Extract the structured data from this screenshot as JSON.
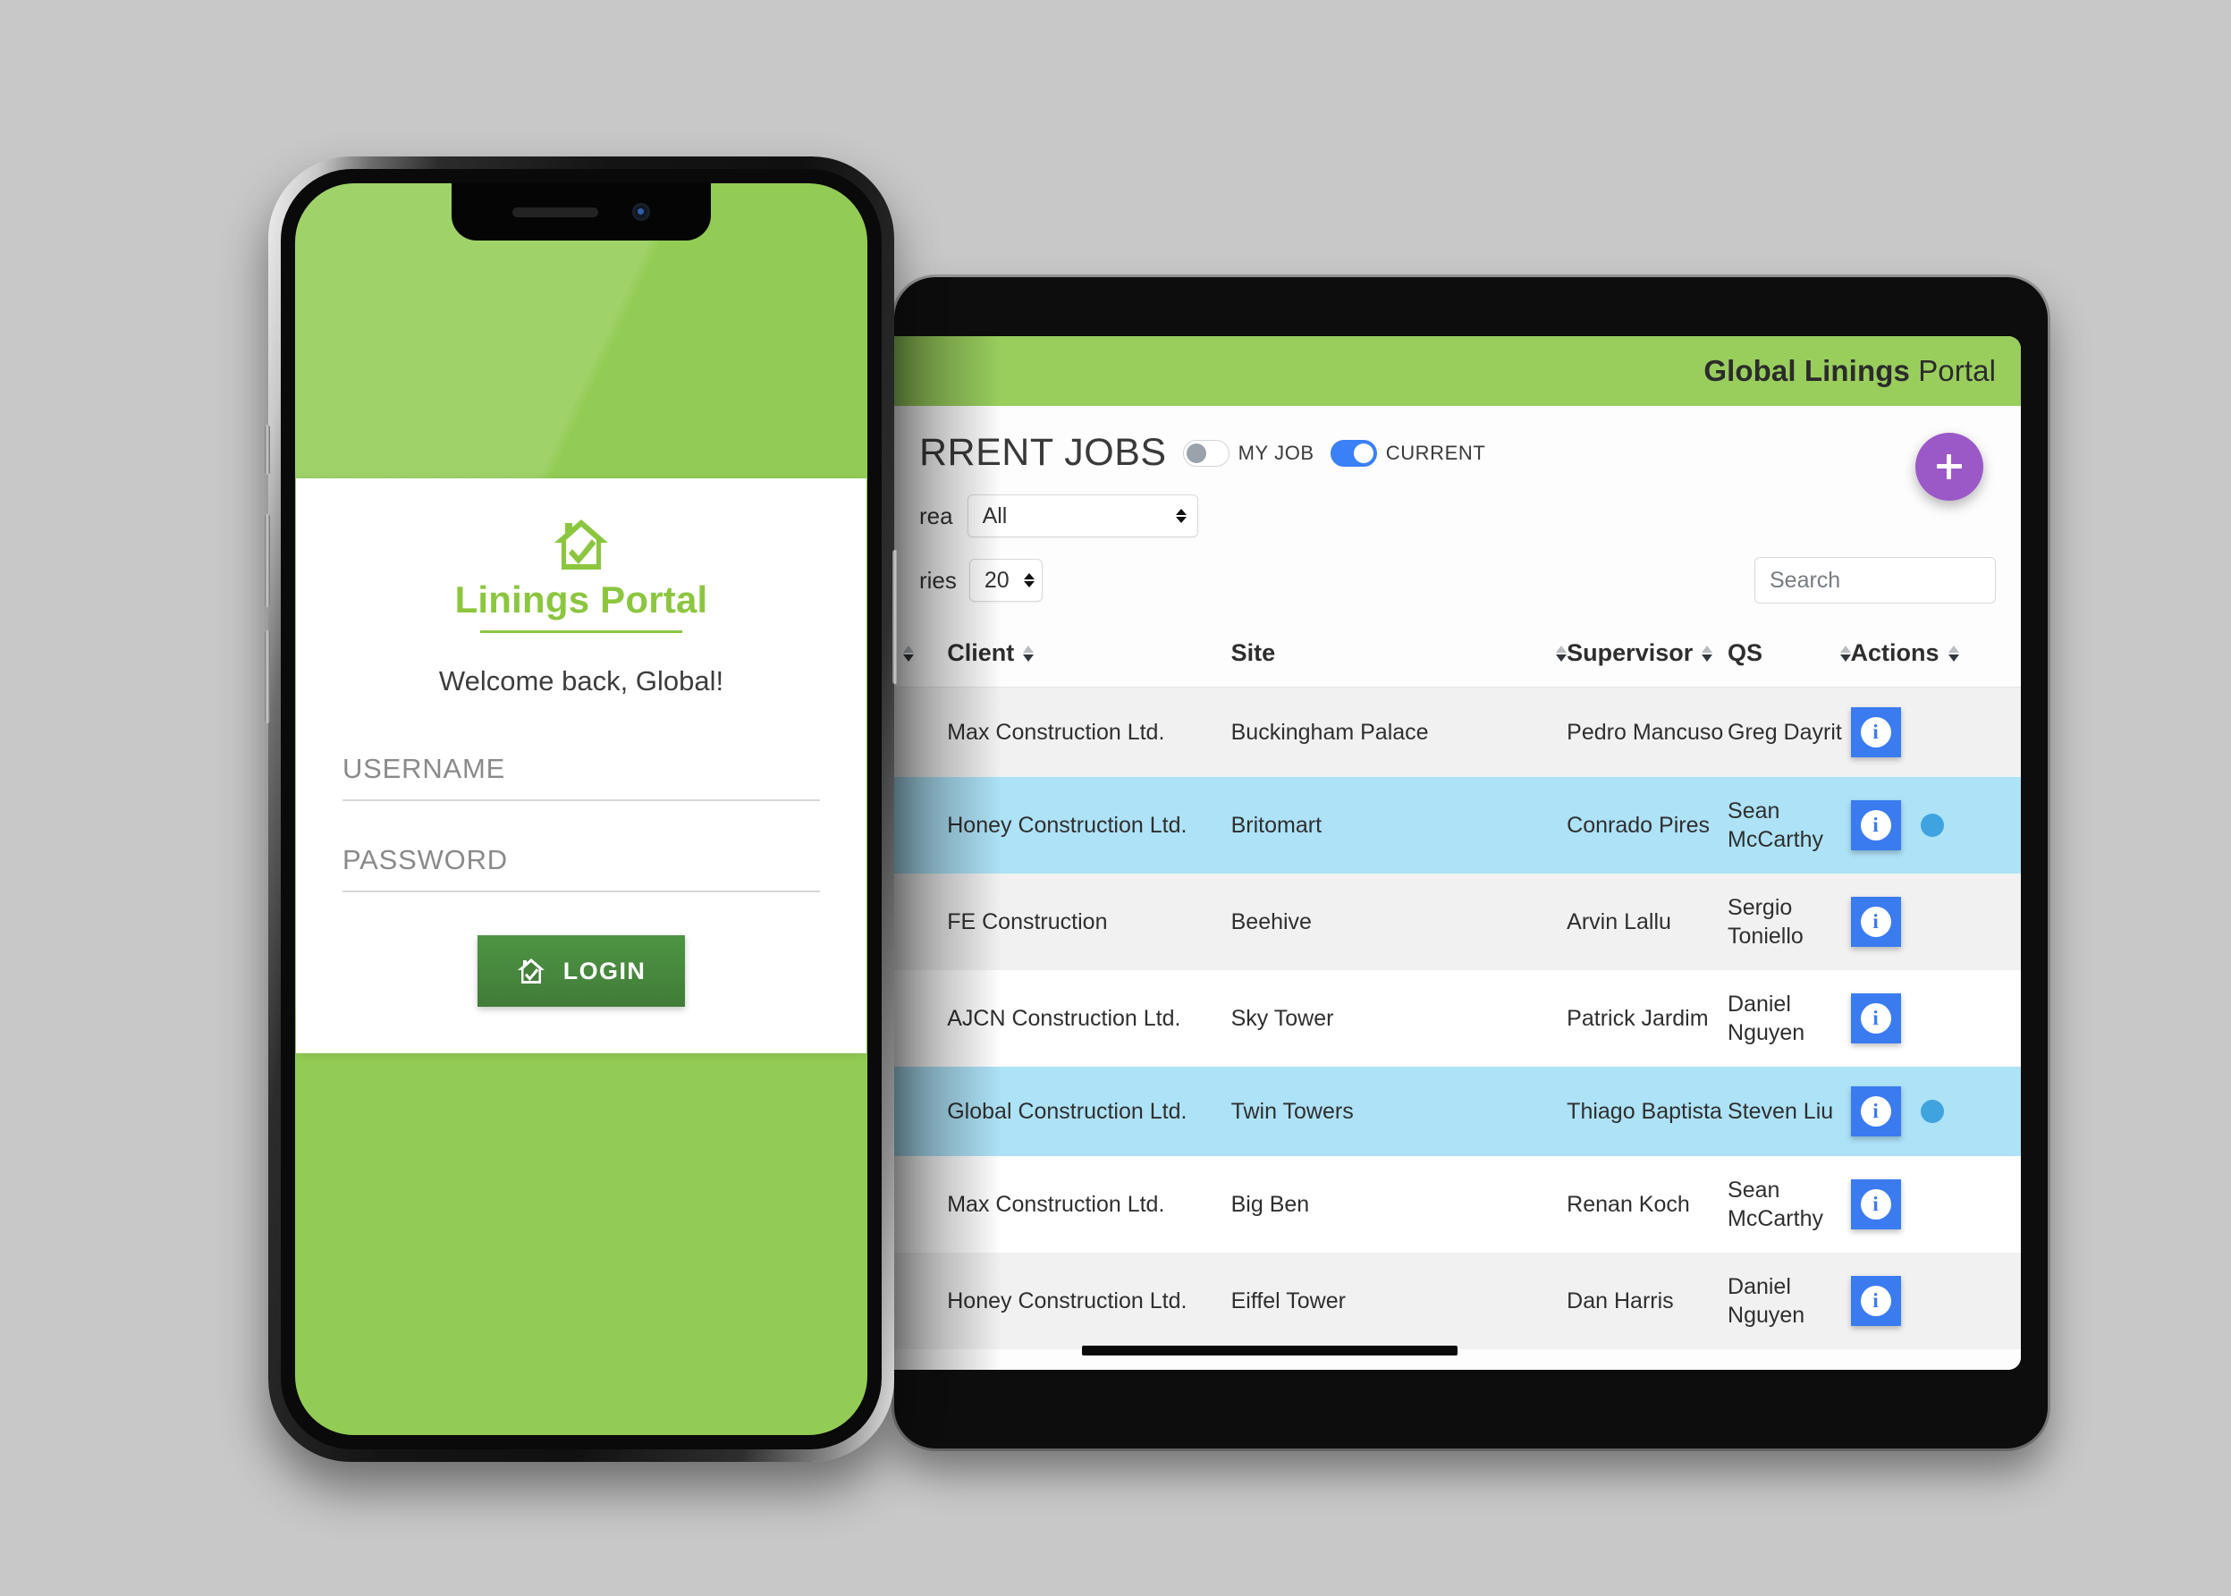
{
  "phone": {
    "app": {
      "logo_icon": "house-check-icon",
      "brand": "Linings Portal",
      "welcome": "Welcome back, Global!",
      "username_label": "USERNAME",
      "username_value": "",
      "password_label": "PASSWORD",
      "password_value": "",
      "login_label": "LOGIN",
      "login_icon": "house-check-icon",
      "brand_color": "#8CC63F",
      "screen_bg": "#93CC55",
      "login_btn_color": "#457F3A"
    }
  },
  "tablet": {
    "header": {
      "title_bold": "Global Linings",
      "title_regular": " Portal",
      "bg_color": "#99CE5D"
    },
    "page": {
      "heading": "RRENT JOBS",
      "toggles": [
        {
          "name": "my-job",
          "label": "MY JOB",
          "on": false
        },
        {
          "name": "current",
          "label": "CURRENT",
          "on": true
        }
      ],
      "area_filter": {
        "label": "rea",
        "value": "All"
      },
      "entries_filter": {
        "label": "ries",
        "value": "20"
      },
      "search": {
        "placeholder": "Search",
        "value": ""
      },
      "add_button": {
        "icon": "plus-icon",
        "color": "#9B59C8"
      }
    },
    "table": {
      "columns": [
        "Client",
        "Site",
        "Supervisor",
        "QS",
        "Actions"
      ],
      "rows": [
        {
          "client": "Max Construction Ltd.",
          "site": "Buckingham Palace",
          "supervisor": "Pedro Mancuso",
          "qs": "Greg Dayrit",
          "selected": false,
          "dot": false
        },
        {
          "client": "Honey Construction Ltd.",
          "site": "Britomart",
          "supervisor": "Conrado Pires",
          "qs": "Sean McCarthy",
          "selected": true,
          "dot": true
        },
        {
          "client": "FE Construction",
          "site": "Beehive",
          "supervisor": "Arvin Lallu",
          "qs": "Sergio Toniello",
          "selected": false,
          "dot": false
        },
        {
          "client": "AJCN Construction Ltd.",
          "site": "Sky Tower",
          "supervisor": "Patrick Jardim",
          "qs": "Daniel Nguyen",
          "selected": false,
          "dot": false
        },
        {
          "client": "Global Construction Ltd.",
          "site": "Twin Towers",
          "supervisor": "Thiago Baptista",
          "qs": "Steven Liu",
          "selected": true,
          "dot": true
        },
        {
          "client": "Max Construction Ltd.",
          "site": "Big Ben",
          "supervisor": "Renan Koch",
          "qs": "Sean McCarthy",
          "selected": false,
          "dot": false
        },
        {
          "client": "Honey Construction Ltd.",
          "site": "Eiffel Tower",
          "supervisor": "Dan Harris",
          "qs": "Daniel Nguyen",
          "selected": false,
          "dot": false
        }
      ],
      "action_icon": "info-icon",
      "action_color": "#3A7BF0",
      "selected_row_color": "#ADE2F7"
    }
  }
}
